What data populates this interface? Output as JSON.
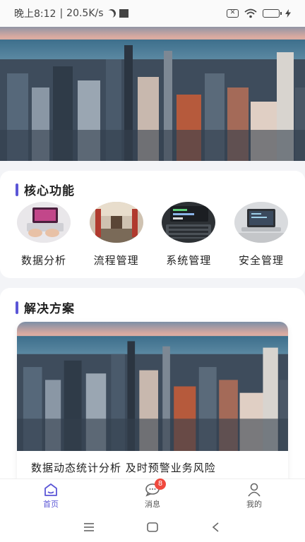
{
  "status_bar": {
    "time": "晚上8:12",
    "network_speed": "20.5K/s",
    "icons": [
      "moon-icon",
      "square-icon",
      "sim-x-icon",
      "wifi-icon",
      "battery-icon",
      "charging-icon"
    ]
  },
  "banner": {
    "image": "city-skyline-photo"
  },
  "core_functions": {
    "title": "核心功能",
    "items": [
      {
        "label": "数据分析",
        "image": "laptop-typing-photo"
      },
      {
        "label": "流程管理",
        "image": "subway-tunnel-photo"
      },
      {
        "label": "系统管理",
        "image": "keyboard-photo"
      },
      {
        "label": "安全管理",
        "image": "laptop-desk-photo"
      }
    ]
  },
  "solutions": {
    "title": "解决方案",
    "card": {
      "image": "city-skyline-photo",
      "caption": "数据动态统计分析 及时预警业务风险"
    }
  },
  "tab_bar": {
    "tabs": [
      {
        "label": "首页",
        "icon": "home-icon",
        "active": true
      },
      {
        "label": "消息",
        "icon": "message-icon",
        "badge": "8"
      },
      {
        "label": "我的",
        "icon": "user-icon"
      }
    ]
  },
  "colors": {
    "accent": "#5b56d6",
    "badge": "#f0493e",
    "background": "#f3f4f7"
  }
}
